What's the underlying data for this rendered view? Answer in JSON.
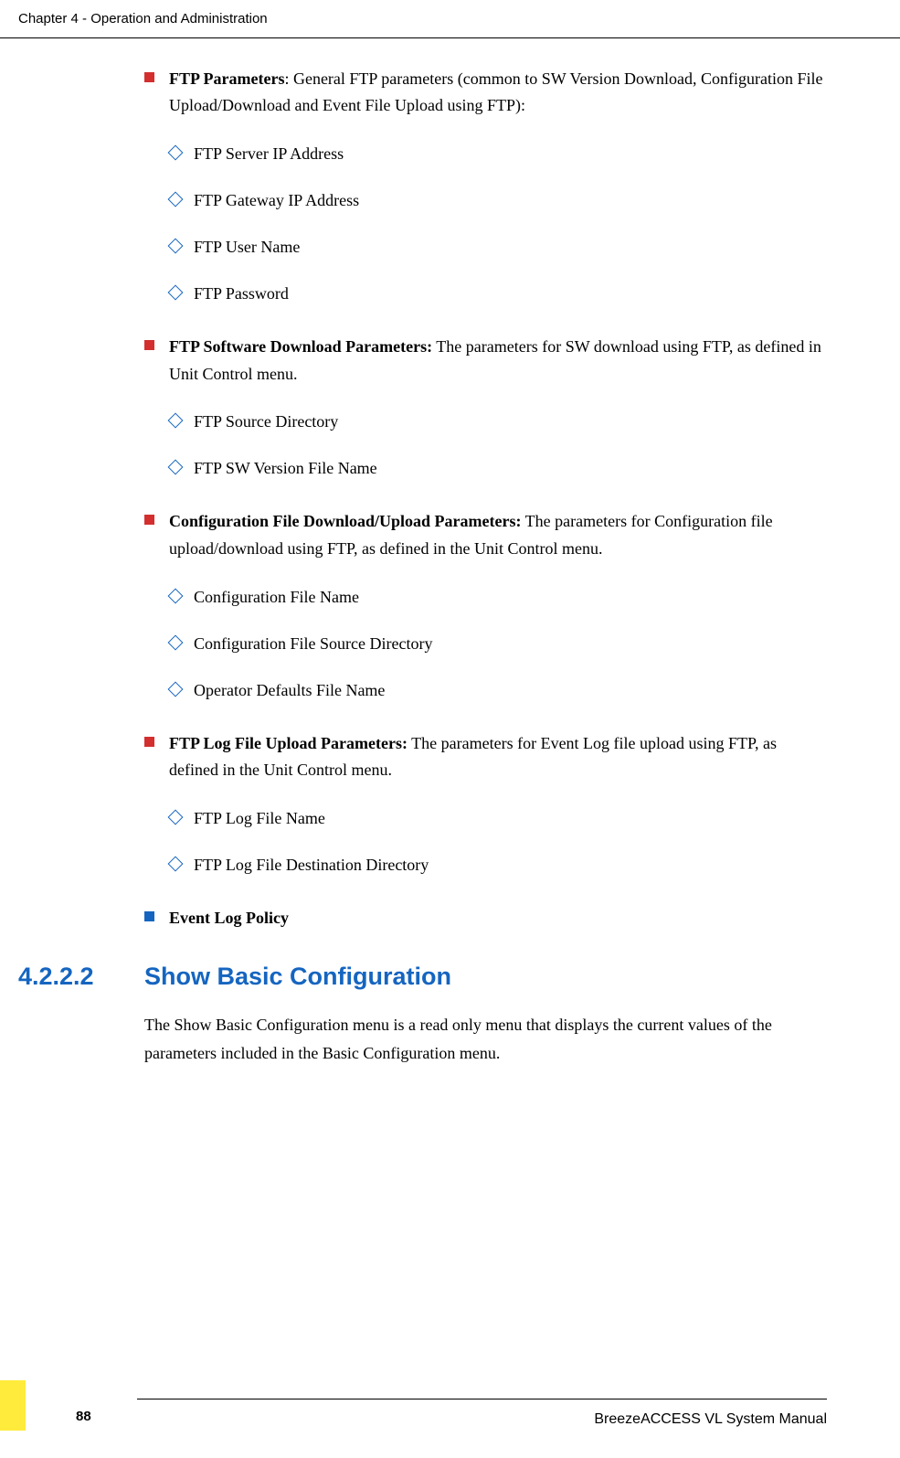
{
  "header": {
    "chapter": "Chapter 4 - Operation and Administration"
  },
  "content": {
    "items": [
      {
        "bold": "FTP Parameters",
        "text": ": General FTP parameters (common to SW Version Download, Configuration File Upload/Download and Event File Upload using FTP):",
        "color": "red",
        "sub": [
          "FTP Server IP Address",
          "FTP Gateway IP Address",
          "FTP User Name",
          "FTP Password"
        ]
      },
      {
        "bold": "FTP Software Download Parameters:",
        "text": " The parameters for SW download using FTP, as defined in Unit Control menu.",
        "color": "red",
        "sub": [
          "FTP Source Directory",
          "FTP SW Version File Name"
        ]
      },
      {
        "bold": "Configuration File Download/Upload Parameters:",
        "text": " The parameters for Configuration file upload/download using FTP, as defined in the Unit Control menu.",
        "color": "red",
        "sub": [
          "Configuration File Name",
          "Configuration File Source Directory",
          "Operator Defaults File Name"
        ]
      },
      {
        "bold": "FTP Log File Upload Parameters:",
        "text": " The parameters for Event Log file upload using FTP, as defined in the Unit Control menu.",
        "color": "red",
        "sub": [
          "FTP Log File Name",
          "FTP Log File Destination Directory"
        ]
      },
      {
        "bold": "Event Log Policy",
        "text": "",
        "color": "blue",
        "sub": []
      }
    ]
  },
  "section": {
    "number": "4.2.2.2",
    "title": "Show Basic Configuration",
    "body": "The Show Basic Configuration menu is a read only menu that displays the current values of the parameters included in the Basic Configuration menu."
  },
  "footer": {
    "page": "88",
    "manual": "BreezeACCESS VL System Manual"
  }
}
